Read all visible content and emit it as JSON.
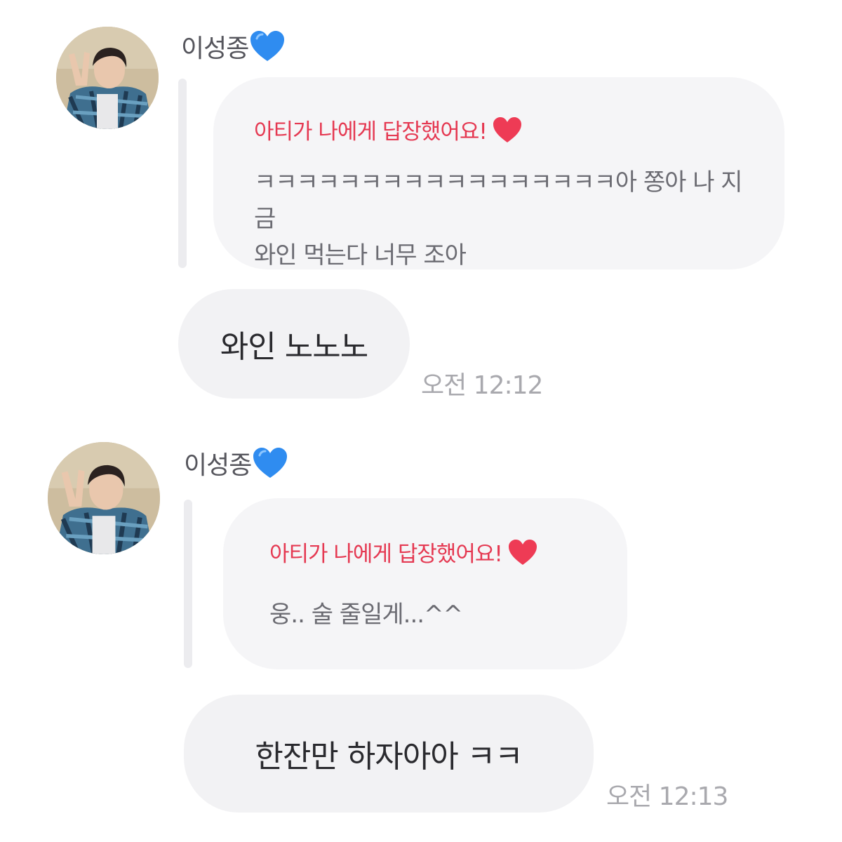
{
  "messages": [
    {
      "sender": "이성종",
      "sender_icon": "blue-heart-icon",
      "reply_header": "아티가 나에게 답장했어요!",
      "reply_header_icon": "red-heart-icon",
      "reply_text": "ㅋㅋㅋㅋㅋㅋㅋㅋㅋㅋㅋㅋㅋㅋㅋㅋㅋ아 쫑아 나 지금\n와인 먹는다 너무 조아",
      "message": "와인 노노노",
      "time": "오전 12:12"
    },
    {
      "sender": "이성종",
      "sender_icon": "blue-heart-icon",
      "reply_header": "아티가 나에게 답장했어요!",
      "reply_header_icon": "red-heart-icon",
      "reply_text": "웅.. 술 줄일게...^^",
      "message": "한잔만 하자아아 ㅋㅋ",
      "time": "오전 12:13"
    }
  ],
  "colors": {
    "reply_header": "#e53952",
    "heart_blue": "#2f8cf0",
    "heart_red": "#ee3b55",
    "bubble_bg": "#f2f2f4",
    "time": "#a9a9ae"
  }
}
